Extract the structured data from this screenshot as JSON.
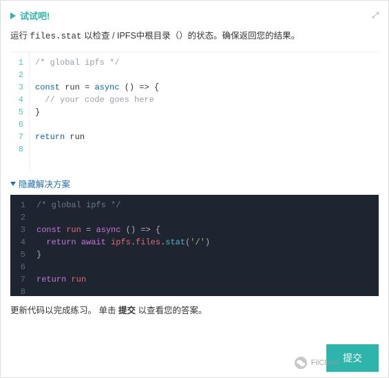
{
  "header": {
    "title": "试试吧!"
  },
  "instruction": {
    "pre": "运行 ",
    "code": "files.stat",
    "mid": " 以检查 / IPFS中根目录（）的状态。确保返回您的结果。"
  },
  "editor_light": {
    "gutter": "1\n2\n3\n4\n5\n6\n7\n8",
    "l1_comment": "/* global ipfs */",
    "l3_kw_const": "const",
    "l3_name": " run ",
    "l3_eq": "= ",
    "l3_kw_async": "async",
    "l3_rest": " () => {",
    "l4_comment": "  // your code goes here",
    "l5": "}",
    "l7_kw_return": "return",
    "l7_rest": " run"
  },
  "solution_toggle": "隐藏解决方案",
  "editor_dark": {
    "gutter": "1\n2\n3\n4\n5\n6\n7\n8",
    "l1_comment": "/* global ipfs */",
    "l3_kw_const": "const",
    "l3_name": " run ",
    "l3_eq": "= ",
    "l3_kw_async": "async",
    "l3_rest": " () => {",
    "l4_kw_return": "  return",
    "l4_kw_await": " await",
    "l4_obj": " ipfs",
    "l4_dot1": ".",
    "l4_files": "files",
    "l4_dot2": ".",
    "l4_fn": "stat",
    "l4_p1": "(",
    "l4_str": "'/'",
    "l4_p2": ")",
    "l5": "}",
    "l7_kw_return": "return",
    "l7_rest": " run"
  },
  "footer": {
    "text_a": "更新代码以完成练习。 单击 ",
    "text_b": "提交",
    "text_c": " 以查看您的答案。"
  },
  "submit_label": "提交",
  "watermark": "FilCloud"
}
